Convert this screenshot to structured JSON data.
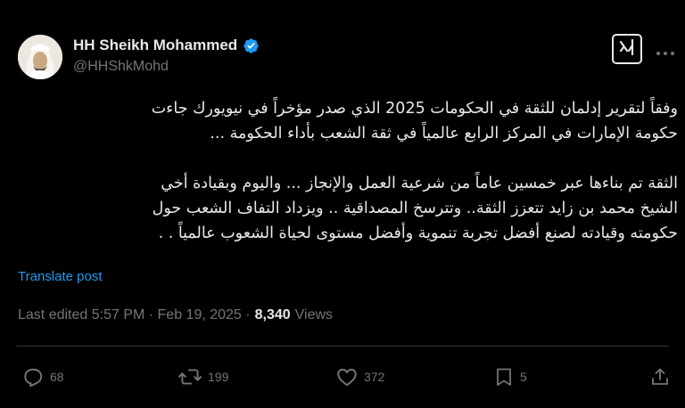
{
  "post": {
    "author": {
      "display_name": "HH Sheikh Mohammed",
      "handle": "@HHShkMohd",
      "verified": true
    },
    "text": {
      "para1_line1": "وفقاً لتقرير إدلمان للثقة في الحكومات 2025 الذي صدر مؤخراً في نيويورك جاءت",
      "para1_line2": "حكومة الإمارات في المركز الرابع عالمياً في ثقة الشعب بأداء الحكومة ...",
      "para2_line1": "الثقة تم بناءها عبر خمسين عاماً من شرعية العمل والإنجاز ... واليوم وبقيادة أخي",
      "para2_line2": "الشيخ محمد بن زايد تتعزز الثقة.. وتترسخ المصداقية .. ويزداد التفاف الشعب حول",
      "para2_line3": "حكومته وقيادته لصنع أفضل تجربة تنموية وأفضل مستوى لحياة الشعوب عالمياً . ."
    },
    "translate_label": "Translate post",
    "meta": {
      "edited_time": "Last edited 5:57 PM · Feb 19, 2025 ·",
      "views_count": "8,340",
      "views_label": "Views"
    },
    "actions": {
      "replies": "68",
      "reposts": "199",
      "likes": "372",
      "bookmarks": "5"
    }
  },
  "colors": {
    "background": "#000000",
    "primary_text": "#e7e9ea",
    "secondary_text": "#71767b",
    "link": "#1d9bf0",
    "verified_badge": "#1d9bf0",
    "divider": "#2f3336"
  },
  "icons": [
    "verified-badge-icon",
    "grok-icon",
    "more-icon",
    "reply-icon",
    "repost-icon",
    "like-icon",
    "bookmark-icon",
    "share-icon"
  ]
}
